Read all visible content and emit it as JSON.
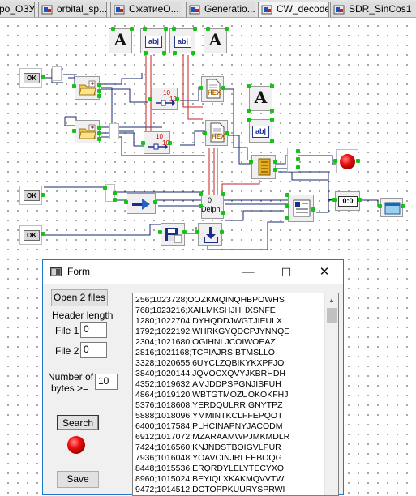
{
  "tabs": [
    {
      "label": "ро_ОЗУ"
    },
    {
      "label": "orbital_sp..."
    },
    {
      "label": "СжатиеО..."
    },
    {
      "label": "Generatio..."
    },
    {
      "label": "CW_decoder"
    },
    {
      "label": "SDR_SinCos1"
    }
  ],
  "canvas": {
    "ok_button_label": "OK",
    "counter_label": "10",
    "hex_label": "HEX",
    "timer_label": "0:0",
    "delphi_label": "Delphi",
    "delphi_count": "0"
  },
  "form": {
    "title": "Form",
    "minimize": "—",
    "maximize": "☐",
    "close": "✕",
    "open_button": "Open 2 files",
    "header_length_label": "Header length",
    "file1_label": "File 1",
    "file1_value": "0",
    "file2_label": "File 2",
    "file2_value": "0",
    "num_bytes_label_line1": "Number of",
    "num_bytes_label_line2": "bytes >=",
    "num_bytes_value": "10",
    "search_button": "Search",
    "save_button": "Save",
    "memo_lines": [
      "256;1023728;OOZKMQINQHBPOWHS",
      "768;1023216;XAILMKSHJHHXSNFE",
      "1280;1022704;DYHQDDJWGTJIEULX",
      "1792;1022192;WHRKGYQDCPJYNNQE",
      "2304;1021680;OGIHNLJCOIWOEAZ",
      "2816;1021168;TCPIAJRSIBTMSLLO",
      "3328;1020655;6UYCLZQBIKYKXPFJO",
      "3840;1020144;JQVOCXQVYJKBRHDH",
      "4352;1019632;AMJDDPSPGNJISFUH",
      "4864;1019120;WBTGTMOZUOKOKFHJ",
      "5376;1018608;YERDQULRRIGNYTPZ",
      "5888;1018096;YMMINTKCLFFEPQOT",
      "6400;1017584;PLHCINAPNYJACODM",
      "6912;1017072;MZARAAMWPJMKMDLR",
      "7424;1016560;KNJNDSTBOIGVLPUR",
      "7936;1016048;YOAVCINJRLEEBOQG",
      "8448;1015536;ERQRDYLELYTECYXQ",
      "8960;1015024;BEYIQLXKAKMQVVTW",
      "9472;1014512;DCTOPPKUURYSPRWI"
    ]
  },
  "colors": {
    "wire_blue": "#1a2a6e",
    "wire_red": "#c82020",
    "pin_green": "#16c216",
    "led_red": "#e01010",
    "window_border": "#1e7ac8"
  }
}
